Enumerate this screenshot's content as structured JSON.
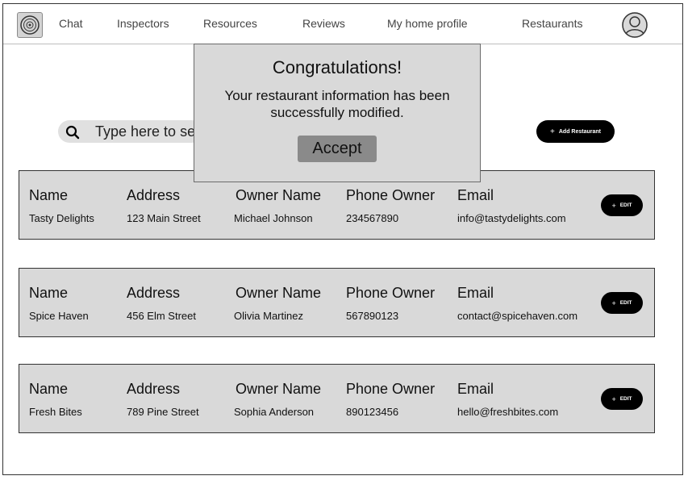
{
  "nav": {
    "logo_icon": "restaurant-logo-icon",
    "links": [
      "Chat",
      "Inspectors",
      "Resources",
      "Reviews",
      "My home profile",
      "Restaurants"
    ],
    "avatar_icon": "user-avatar-icon"
  },
  "search": {
    "placeholder": "Type here to search"
  },
  "add_button": {
    "label": "Add Restaurant"
  },
  "labels": {
    "name": "Name",
    "address": "Address",
    "owner": "Owner Name",
    "phone": "Phone Owner",
    "email": "Email"
  },
  "edit_label": "EDIT",
  "restaurants": [
    {
      "name": "Tasty Delights",
      "address": "123 Main Street",
      "owner": "Michael Johnson",
      "phone": "234567890",
      "email": "info@tastydelights.com"
    },
    {
      "name": "Spice Haven",
      "address": "456 Elm Street",
      "owner": "Olivia Martinez",
      "phone": "567890123",
      "email": "contact@spicehaven.com"
    },
    {
      "name": "Fresh Bites",
      "address": "789 Pine Street",
      "owner": "Sophia Anderson",
      "phone": "890123456",
      "email": "hello@freshbites.com"
    }
  ],
  "modal": {
    "title": "Congratulations!",
    "message": "Your restaurant information has been successfully modified.",
    "accept_label": "Accept"
  },
  "colors": {
    "card_bg": "#d9d9d9",
    "button_bg": "#000000",
    "accept_bg": "#8a8a8a"
  }
}
